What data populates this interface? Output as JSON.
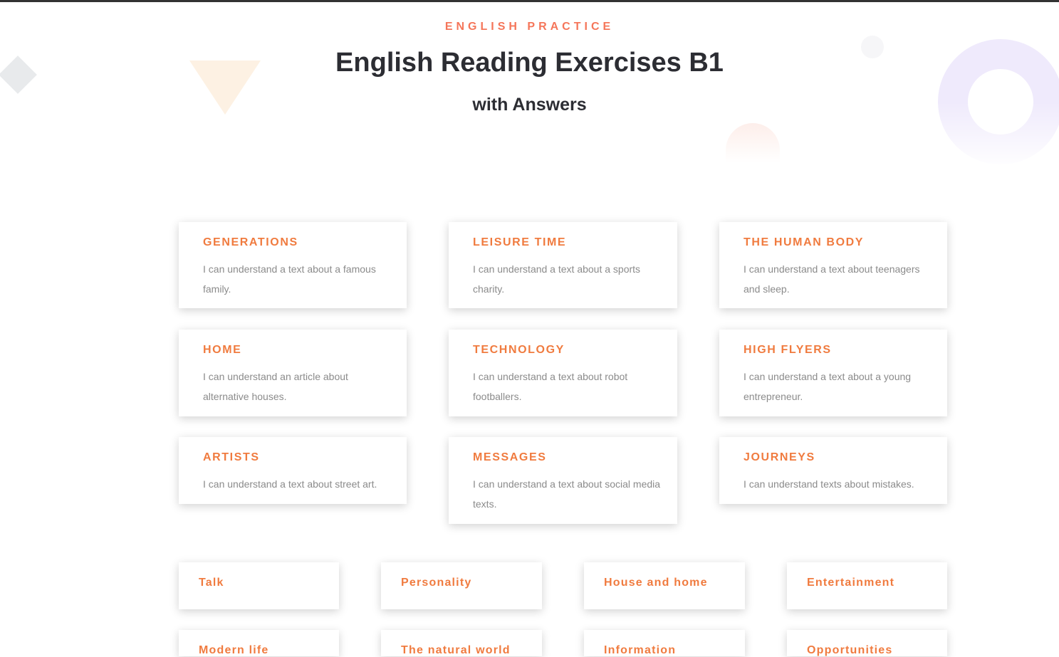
{
  "header": {
    "kicker": "ENGLISH PRACTICE",
    "title": "English Reading Exercises B1",
    "subtitle": "with Answers"
  },
  "units": [
    {
      "title": "GENERATIONS",
      "desc": "I can understand a text about a famous family."
    },
    {
      "title": "LEISURE TIME",
      "desc": "I can understand a text about a sports charity."
    },
    {
      "title": "THE HUMAN BODY",
      "desc": "I can understand a text about teenagers and sleep."
    },
    {
      "title": "HOME",
      "desc": "I can understand an article about alternative houses."
    },
    {
      "title": "TECHNOLOGY",
      "desc": "I can understand a text about robot footballers."
    },
    {
      "title": "HIGH FLYERS",
      "desc": "I can understand a text about a young entrepreneur."
    },
    {
      "title": "ARTISTS",
      "desc": "I can understand a text about street art."
    },
    {
      "title": "MESSAGES",
      "desc": "I can understand a text about social media texts."
    },
    {
      "title": "JOURNEYS",
      "desc": "I can understand texts about mistakes."
    }
  ],
  "topics": [
    "Talk",
    "Personality",
    "House and home",
    "Entertainment",
    "Modern life",
    "The natural world",
    "Information",
    "Opportunities"
  ],
  "colors": {
    "accent": "#f07b3f",
    "kicker": "#f5765a",
    "heading": "#2c2d33",
    "body_text": "#8b8b8b"
  }
}
